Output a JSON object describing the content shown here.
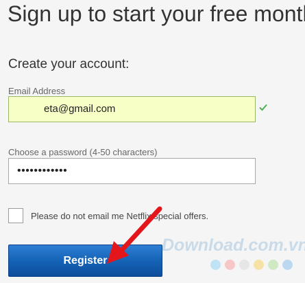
{
  "headline": "Sign up to start your free month",
  "form": {
    "subheading": "Create your account:",
    "email": {
      "label": "Email Address",
      "value": "eta@gmail.com"
    },
    "password": {
      "label": "Choose a password (4-50 characters)",
      "value": "••••••••••••"
    },
    "opt_out": {
      "label": "Please do not email me Netflix special offers.",
      "checked": false
    },
    "register_label": "Register"
  },
  "colors": {
    "button": "#1563b6",
    "email_bg": "#f7ffc6",
    "arrow": "#e4161b",
    "check": "#4caf50"
  },
  "watermark": {
    "text": "Download.com.vn",
    "dot_colors": [
      "#bfe3f5",
      "#f7c7c7",
      "#e6e6e6",
      "#f7e2a6",
      "#cfe9c3",
      "#bcd8f0"
    ]
  }
}
